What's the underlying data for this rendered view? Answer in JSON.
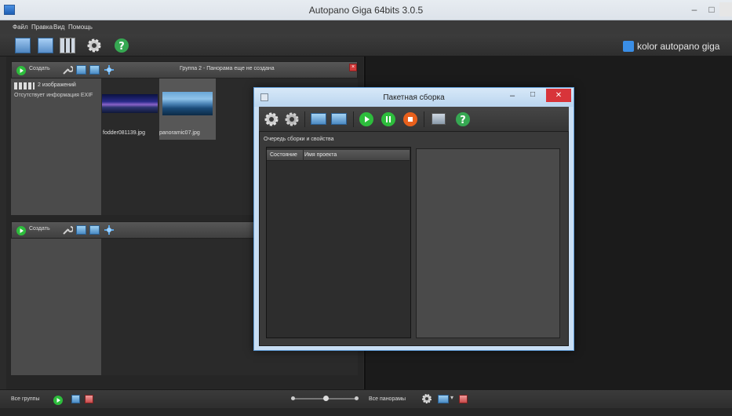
{
  "window": {
    "title": "Autopano Giga 64bits 3.0.5",
    "controls": [
      "–",
      "□",
      "✕"
    ]
  },
  "menu": [
    "Файл",
    "Правка",
    "Вид",
    "Помощь"
  ],
  "brand": "kolor autopano giga",
  "groups": {
    "create_label": "Создать",
    "group_title": "Группа 2 - Панорама еще не создана",
    "image_count_label": "2 изображений",
    "exif_note": "Отсутствует информация EXIF",
    "images": [
      {
        "name": "fodder081139.jpg"
      },
      {
        "name": "panoramic07.jpg"
      }
    ]
  },
  "bottom": {
    "all_groups": "Все группы",
    "all_panoramas": "Все панорамы"
  },
  "dialog": {
    "title": "Пакетная сборка",
    "queue_label": "Очередь сборки и свойства",
    "columns": [
      "Состояние",
      "Имя проекта"
    ],
    "controls": [
      "–",
      "□",
      "✕"
    ]
  },
  "colors": {
    "accent_blue": "#3a8ee6",
    "play_green": "#2dbd3c",
    "stop_orange": "#e8601c",
    "close_red": "#d8343a"
  }
}
